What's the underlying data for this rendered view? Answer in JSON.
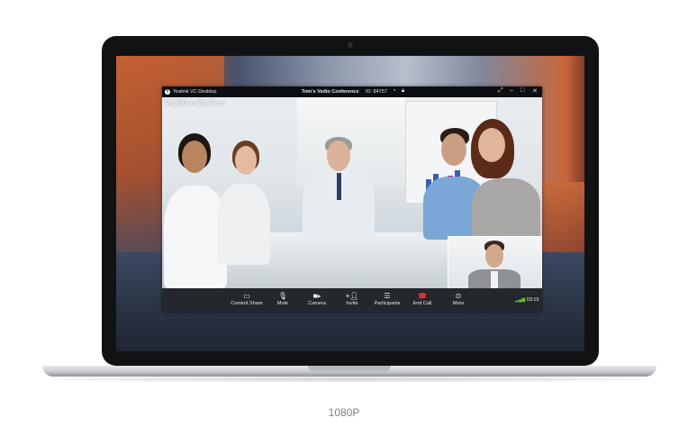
{
  "app": {
    "name": "Yealink VC Desktop",
    "conference_title": "Tom's Vedio Conference",
    "conference_id": "ID: 84757"
  },
  "video": {
    "room_label": "VC800 in 5th Floor"
  },
  "toolbar": {
    "buttons": [
      {
        "label": "Content Share",
        "icon": "monitor-icon"
      },
      {
        "label": "Mute",
        "icon": "microphone-icon"
      },
      {
        "label": "Camera",
        "icon": "camera-icon"
      },
      {
        "label": "Invite",
        "icon": "add-person-icon"
      },
      {
        "label": "Participants",
        "icon": "participants-icon"
      },
      {
        "label": "End Call",
        "icon": "end-call-icon"
      },
      {
        "label": "More",
        "icon": "more-icon"
      }
    ],
    "call_duration": "03:15"
  },
  "caption": "1080P",
  "colors": {
    "end_call": "#e0342f",
    "signal": "#5fbf3a",
    "titlebar": "#0d0f12"
  }
}
